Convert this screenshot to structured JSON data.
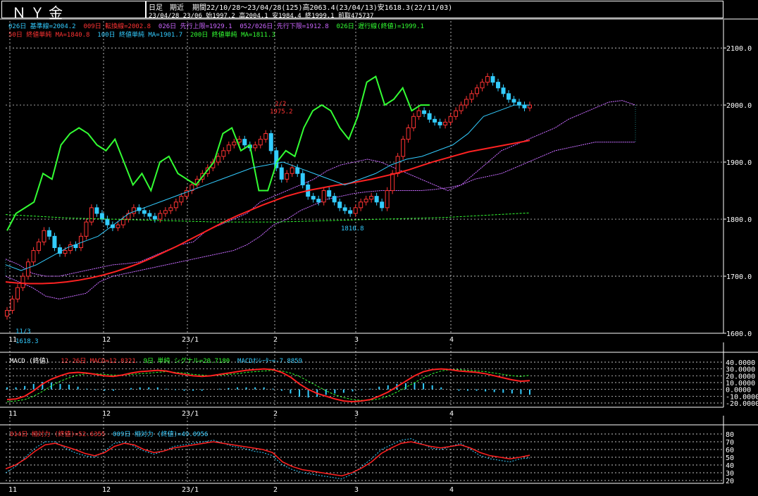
{
  "header": {
    "title": "ＮＹ金",
    "mode": "日足　期近",
    "period_info": "期間22/10/28～23/04/28(125)高2063.4(23/04/13)安1618.3(22/11/03)",
    "last_info": "23/04/28 23/06 始1997.2 高2004.1 安1984.4 終1999.1 前取475737"
  },
  "legend": {
    "row1": [
      {
        "text": "026日 基準線=2004.2",
        "color": "#33ccff"
      },
      {
        "text": "009日 転換線=2002.8",
        "color": "#ff3333"
      },
      {
        "text": "026日 先行上限=1929.1",
        "color": "#cc66ff"
      },
      {
        "text": "052/026日 先行下限=1912.8",
        "color": "#cc66ff"
      },
      {
        "text": "026日 遅行線(終値)=1999.1",
        "color": "#33ff33"
      }
    ],
    "row2": [
      {
        "text": "50日 終値単純 MA=1840.8",
        "color": "#ff3333"
      },
      {
        "text": "100日 終値単純 MA=1901.7",
        "color": "#33ccff"
      },
      {
        "text": "200日 終値単純 MA=1811.3",
        "color": "#33ff33"
      }
    ]
  },
  "macd_legend": [
    {
      "text": "MACD (終値)",
      "color": "#ffffff"
    },
    {
      "text": "12-26日 MACD=12.8321",
      "color": "#ff3333"
    },
    {
      "text": "9日 単純 シグナル=20.7180",
      "color": "#33ff33"
    },
    {
      "text": "MACDｵｼﾚｰﾀｰ=-7.8859",
      "color": "#33ccff"
    }
  ],
  "rsi_legend": [
    {
      "text": "014日 相対力 (終値)=52.6355",
      "color": "#ff3333"
    },
    {
      "text": "009日 相対力 (終値)=49.0956",
      "color": "#33ccff"
    }
  ],
  "annotations": {
    "low_date": "11/3",
    "low_value": "1618.3",
    "high_date": "4/13",
    "high_value": "2063.4",
    "mid_date": "2/2",
    "mid_value": "1975.2",
    "low2_value": "1810.8"
  },
  "chart_data": [
    {
      "type": "candlestick",
      "title": "ＮＹ金",
      "x_ticks": [
        "11",
        "12",
        "23/1",
        "2",
        "3",
        "4"
      ],
      "y_ticks": [
        "2100.0",
        "2000.0",
        "1900.0",
        "1800.0",
        "1700.0",
        "1600.0"
      ],
      "ylim": [
        1600,
        2110
      ],
      "grid": true,
      "ohlc_close_approx": [
        1640,
        1660,
        1680,
        1700,
        1725,
        1745,
        1760,
        1780,
        1770,
        1750,
        1740,
        1745,
        1755,
        1750,
        1770,
        1795,
        1820,
        1810,
        1800,
        1790,
        1785,
        1790,
        1800,
        1810,
        1820,
        1815,
        1810,
        1805,
        1800,
        1810,
        1815,
        1820,
        1830,
        1840,
        1850,
        1860,
        1870,
        1880,
        1890,
        1900,
        1910,
        1920,
        1930,
        1935,
        1940,
        1930,
        1925,
        1930,
        1940,
        1950,
        1920,
        1890,
        1870,
        1880,
        1890,
        1880,
        1860,
        1840,
        1835,
        1830,
        1850,
        1840,
        1830,
        1820,
        1815,
        1810,
        1820,
        1830,
        1835,
        1840,
        1830,
        1820,
        1850,
        1880,
        1910,
        1940,
        1960,
        1980,
        1990,
        1985,
        1975,
        1970,
        1965,
        1970,
        1980,
        1990,
        2000,
        2010,
        2020,
        2030,
        2040,
        2050,
        2040,
        2030,
        2020,
        2010,
        2005,
        2000,
        1995,
        2000
      ],
      "series": [
        {
          "name": "50日 終値単純 MA",
          "values": [
            1690,
            1688,
            1687,
            1687,
            1688,
            1690,
            1693,
            1697,
            1702,
            1708,
            1715,
            1723,
            1732,
            1742,
            1752,
            1763,
            1774,
            1785,
            1796,
            1806,
            1815,
            1824,
            1832,
            1840,
            1846,
            1851,
            1855,
            1859,
            1862,
            1866,
            1870,
            1875,
            1880,
            1886,
            1893,
            1900,
            1906,
            1912,
            1918,
            1922,
            1926,
            1930,
            1934,
            1938
          ]
        },
        {
          "name": "200日 終値単純 MA",
          "values": [
            1808,
            1806,
            1804,
            1802,
            1801,
            1800,
            1799,
            1798,
            1797,
            1796,
            1795,
            1795,
            1795,
            1795,
            1796,
            1797,
            1798,
            1799,
            1800,
            1801,
            1802,
            1803,
            1805,
            1807,
            1809,
            1811
          ]
        }
      ]
    },
    {
      "type": "line",
      "title": "MACD (終値)",
      "y_ticks": [
        "40.0000",
        "30.0000",
        "20.0000",
        "10.0000",
        "0.0000",
        "-10.0000",
        "-20.0000"
      ],
      "ylim": [
        -20,
        40
      ],
      "series": [
        {
          "name": "12-26日 MACD",
          "values": [
            -15,
            -14,
            -10,
            -2,
            8,
            15,
            20,
            24,
            25,
            24,
            22,
            20,
            19,
            21,
            24,
            26,
            27,
            28,
            27,
            24,
            22,
            20,
            19,
            20,
            22,
            24,
            26,
            28,
            29,
            30,
            29,
            25,
            18,
            8,
            0,
            -6,
            -10,
            -14,
            -17,
            -18,
            -17,
            -15,
            -10,
            -4,
            4,
            12,
            20,
            26,
            29,
            30,
            29,
            27,
            26,
            25,
            23,
            20,
            17,
            14,
            12,
            12.8
          ]
        },
        {
          "name": "9日 単純 シグナル",
          "values": [
            -18,
            -17,
            -15,
            -10,
            -3,
            5,
            12,
            17,
            21,
            23,
            23,
            22,
            21,
            21,
            22,
            23,
            24,
            25,
            26,
            25,
            24,
            22,
            21,
            20,
            21,
            22,
            23,
            25,
            26,
            27,
            28,
            27,
            24,
            19,
            12,
            5,
            -2,
            -8,
            -12,
            -15,
            -16,
            -16,
            -14,
            -10,
            -4,
            3,
            10,
            17,
            23,
            27,
            29,
            29,
            28,
            27,
            26,
            24,
            22,
            20,
            19,
            20.7
          ]
        }
      ]
    },
    {
      "type": "line",
      "title": "相対力",
      "y_ticks": [
        "80",
        "70",
        "60",
        "50",
        "40",
        "30",
        "20"
      ],
      "ylim": [
        20,
        80
      ],
      "series": [
        {
          "name": "014日 相対力",
          "values": [
            35,
            40,
            48,
            58,
            66,
            68,
            64,
            60,
            55,
            52,
            56,
            64,
            68,
            66,
            60,
            56,
            58,
            62,
            64,
            66,
            68,
            70,
            68,
            66,
            64,
            62,
            60,
            56,
            44,
            38,
            34,
            32,
            30,
            28,
            26,
            30,
            36,
            44,
            55,
            62,
            68,
            70,
            67,
            64,
            62,
            64,
            66,
            62,
            56,
            52,
            50,
            48,
            50,
            52.6
          ]
        },
        {
          "name": "009日 相対力",
          "values": [
            30,
            38,
            50,
            62,
            70,
            70,
            62,
            56,
            52,
            50,
            58,
            68,
            70,
            64,
            58,
            54,
            58,
            64,
            66,
            68,
            70,
            72,
            68,
            64,
            62,
            58,
            56,
            52,
            40,
            34,
            30,
            28,
            26,
            24,
            22,
            28,
            38,
            48,
            60,
            66,
            72,
            74,
            68,
            62,
            60,
            64,
            68,
            60,
            52,
            48,
            46,
            44,
            48,
            49.1
          ]
        }
      ]
    }
  ]
}
